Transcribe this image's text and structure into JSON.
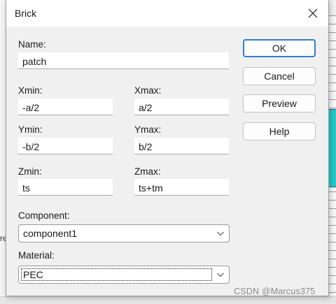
{
  "dialog": {
    "title": "Brick",
    "close_glyph": "✕"
  },
  "form": {
    "name_label": "Name:",
    "name_value": "patch",
    "xmin_label": "Xmin:",
    "xmin_value": "-a/2",
    "xmax_label": "Xmax:",
    "xmax_value": "a/2",
    "ymin_label": "Ymin:",
    "ymin_value": "-b/2",
    "ymax_label": "Ymax:",
    "ymax_value": "b/2",
    "zmin_label": "Zmin:",
    "zmin_value": "ts",
    "zmax_label": "Zmax:",
    "zmax_value": "ts+tm",
    "component_label": "Component:",
    "component_value": "component1",
    "material_label": "Material:",
    "material_value": "PEC"
  },
  "buttons": {
    "ok": "OK",
    "cancel": "Cancel",
    "preview": "Preview",
    "help": "Help"
  },
  "background": {
    "edge_text": "re",
    "watermark": "CSDN @Marcus375"
  },
  "colors": {
    "default_button_border": "#2f7fd0",
    "shape_fill": "#25c9c9"
  }
}
